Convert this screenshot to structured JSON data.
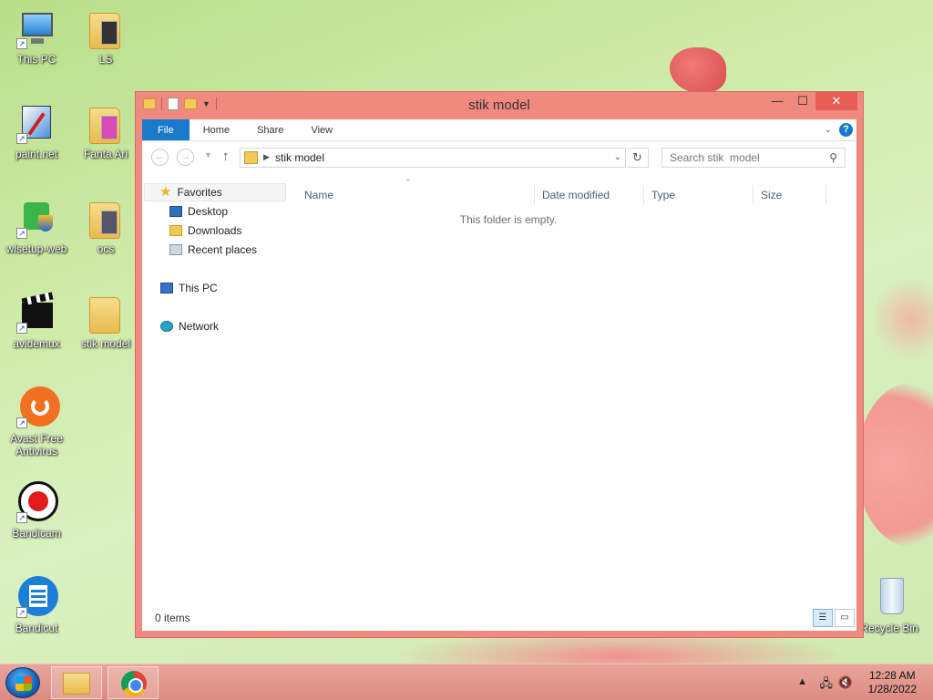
{
  "desktop": {
    "icons": [
      {
        "label": "This PC"
      },
      {
        "label": "LS"
      },
      {
        "label": "paint.net"
      },
      {
        "label": "Fanta Ari"
      },
      {
        "label": "wlsetup-web"
      },
      {
        "label": "ocs"
      },
      {
        "label": "avidemux"
      },
      {
        "label": "stik  model"
      },
      {
        "label": "Avast Free Antivirus"
      },
      {
        "label": "Bandicam"
      },
      {
        "label": "Bandicut"
      },
      {
        "label": "Recycle Bin"
      }
    ]
  },
  "window": {
    "title": "stik  model",
    "controls": {
      "minimize": "—",
      "maximize": "☐",
      "close": "✕"
    },
    "ribbon": {
      "tabs": [
        {
          "label": "File"
        },
        {
          "label": "Home"
        },
        {
          "label": "Share"
        },
        {
          "label": "View"
        }
      ],
      "help": "?"
    },
    "address": {
      "path": "stik  model",
      "search_placeholder": "Search stik  model"
    },
    "nav_pane": {
      "favorites": "Favorites",
      "desktop": "Desktop",
      "downloads": "Downloads",
      "recent": "Recent places",
      "this_pc": "This PC",
      "network": "Network"
    },
    "columns": {
      "name": "Name",
      "date_modified": "Date modified",
      "type": "Type",
      "size": "Size"
    },
    "empty_message": "This folder is empty.",
    "status": {
      "item_count": "0 items"
    }
  },
  "taskbar": {
    "time": "12:28 AM",
    "date": "1/28/2022"
  },
  "colors": {
    "accent": "#1979ca",
    "window_frame": "#f08a80",
    "close_button": "#e85e57"
  }
}
